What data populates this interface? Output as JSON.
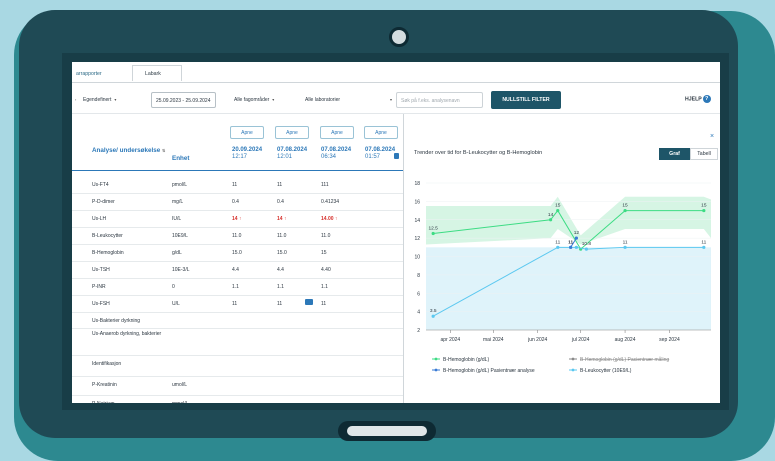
{
  "tabs": {
    "t1": "arrapporter",
    "t2": "Labark"
  },
  "filters": {
    "period": "Egendefinert",
    "date_range": "25.09.2023 - 25.09.2024",
    "fagomrader": "Alle fagområder",
    "laboratorier": "Alle laboratorier",
    "search_placeholder": "Søk på f.eks. analysenavn",
    "reset_label": "NULLSTILL FILTER",
    "help_label": "HJELP"
  },
  "table": {
    "open_label": "Apne",
    "analyse_header": "Analyse/ undersøkelse",
    "enhet_header": "Enhet",
    "columns": [
      {
        "date": "20.09.2024",
        "time": "12:17"
      },
      {
        "date": "07.08.2024",
        "time": "12:01"
      },
      {
        "date": "07.08.2024",
        "time": "06:34"
      },
      {
        "date": "07.08.2024",
        "time": "01:57"
      }
    ],
    "rows": [
      {
        "name": "Us-FT4",
        "unit": "pmol/L",
        "v": [
          "11",
          "11",
          "111",
          ""
        ]
      },
      {
        "name": "P-D-dimer",
        "unit": "mg/L",
        "v": [
          "0.4",
          "0.4",
          "0.41234",
          ""
        ]
      },
      {
        "name": "Us-LH",
        "unit": "IU/L",
        "v": [
          "14",
          "14",
          "14.00",
          ""
        ]
      },
      {
        "name": "B-Leukocytter",
        "unit": "10E9/L",
        "v": [
          "11.0",
          "11.0",
          "11.0",
          ""
        ]
      },
      {
        "name": "B-Hemoglobin",
        "unit": "g/dL",
        "v": [
          "15.0",
          "15.0",
          "15",
          ""
        ]
      },
      {
        "name": "Us-TSH",
        "unit": "10E-3/L",
        "v": [
          "4.4",
          "4.4",
          "4.40",
          ""
        ]
      },
      {
        "name": "P-INR",
        "unit": "0",
        "v": [
          "1.1",
          "1.1",
          "1.1",
          ""
        ]
      },
      {
        "name": "Us-FSH",
        "unit": "U/L",
        "v": [
          "11",
          "11",
          "11",
          ""
        ]
      },
      {
        "name": "Us-Bakterier dyrkning",
        "unit": "",
        "v": [
          "",
          "",
          "",
          ""
        ]
      },
      {
        "name": "Us-Anaerob dyrkning, bakterier",
        "unit": "",
        "v": [
          "",
          "",
          "",
          ""
        ]
      },
      {
        "name": "Identifikasjon",
        "unit": "",
        "v": [
          "",
          "",
          "",
          ""
        ]
      },
      {
        "name": "P-Kreatinin",
        "unit": "umol/L",
        "v": [
          "",
          "",
          "",
          ""
        ]
      },
      {
        "name": "P-Natrium",
        "unit": "mmol/L",
        "v": [
          "",
          "",
          "",
          ""
        ]
      }
    ]
  },
  "chart_panel": {
    "title": "Trender over tid for B-Leukocytter og B-Hemoglobin",
    "toggle_graf": "Graf",
    "toggle_tabell": "Tabell",
    "close": "×"
  },
  "chart_data": {
    "type": "line",
    "x_ticks": [
      "apr 2024",
      "mai 2024",
      "jun 2024",
      "jul 2024",
      "aug 2024",
      "sep 2024"
    ],
    "y_ticks": [
      2,
      4,
      6,
      8,
      10,
      12,
      14,
      16,
      18
    ],
    "ylim": [
      2,
      18
    ],
    "series": [
      {
        "name": "B-Hemoglobin (g/dL)",
        "color": "#3ddc84",
        "points": [
          [
            "2024-03-20",
            12.5
          ],
          [
            "2024-06-10",
            14
          ],
          [
            "2024-06-15",
            15
          ],
          [
            "2024-07-01",
            10.8
          ],
          [
            "2024-08-01",
            15
          ],
          [
            "2024-09-25",
            15
          ]
        ],
        "labels": [
          "12.5",
          "14",
          "15",
          "",
          "15",
          "15"
        ]
      },
      {
        "name": "B-Hemoglobin (g/dL) Pasientnær måling",
        "color": "#8a8a8a",
        "strikethrough": true,
        "points": []
      },
      {
        "name": "B-Hemoglobin (g/dL) Pasientnær analyse",
        "color": "#3a7bd5",
        "points": [
          [
            "2024-06-24",
            11
          ],
          [
            "2024-06-28",
            12
          ]
        ],
        "labels": [
          "11",
          "12"
        ]
      },
      {
        "name": "B-Leukocytter (10E9/L)",
        "color": "#5bc8f0",
        "points": [
          [
            "2024-03-20",
            3.5
          ],
          [
            "2024-06-15",
            11
          ],
          [
            "2024-06-24",
            11
          ],
          [
            "2024-06-28",
            11
          ],
          [
            "2024-07-05",
            10.8
          ],
          [
            "2024-08-01",
            11
          ],
          [
            "2024-09-25",
            11
          ]
        ],
        "labels": [
          "3.5",
          "11",
          "11",
          "",
          "10.8",
          "11",
          "11"
        ]
      }
    ],
    "bands": [
      {
        "color": "#d6f5e4",
        "lower": 12,
        "upper": 16
      },
      {
        "color": "#dff3fa",
        "lower": 2,
        "upper": 11
      }
    ]
  }
}
